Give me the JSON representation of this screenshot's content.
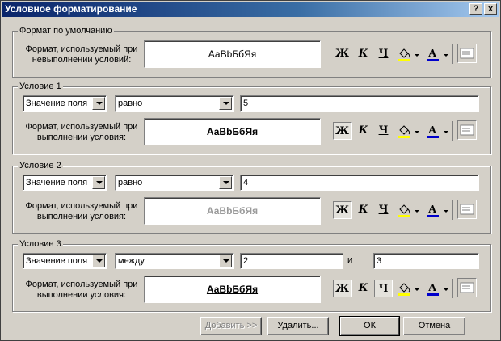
{
  "window": {
    "title": "Условное форматирование",
    "help": "?",
    "close": "x"
  },
  "default_format": {
    "group_label": "Формат по умолчанию",
    "label_line1": "Формат, используемый при",
    "label_line2": "невыполнении условий:",
    "preview": "АаВbБбЯя"
  },
  "conditions": [
    {
      "group_label": "Условие 1",
      "type": "Значение поля",
      "operator": "равно",
      "value1": "5",
      "value2": "",
      "and_label": "",
      "label_line1": "Формат, используемый при",
      "label_line2": "выполнении условия:",
      "preview": "АаВbБбЯя"
    },
    {
      "group_label": "Условие 2",
      "type": "Значение поля",
      "operator": "равно",
      "value1": "4",
      "value2": "",
      "and_label": "",
      "label_line1": "Формат, используемый при",
      "label_line2": "выполнении условия:",
      "preview": "АаВbБбЯя"
    },
    {
      "group_label": "Условие 3",
      "type": "Значение поля",
      "operator": "между",
      "value1": "2",
      "value2": "3",
      "and_label": "и",
      "label_line1": "Формат, используемый при",
      "label_line2": "выполнении условия:",
      "preview": "АаВbБбЯя"
    }
  ],
  "format_buttons": {
    "bold": "Ж",
    "italic": "К",
    "underline": "Ч"
  },
  "buttons": {
    "add": "Добавить >>",
    "delete": "Удалить...",
    "ok": "ОК",
    "cancel": "Отмена"
  },
  "colors": {
    "title_start": "#0a246a",
    "title_end": "#a6caf0",
    "fill_color": "#ffff00",
    "font_color": "#0000cc",
    "dimmed_preview": "#9a9a9a"
  }
}
